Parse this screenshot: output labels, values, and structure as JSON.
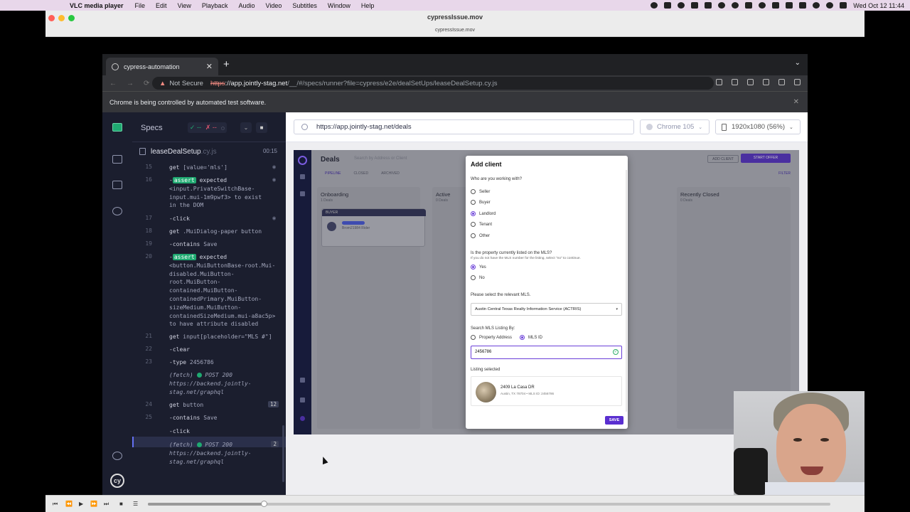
{
  "menubar": {
    "app_name": "VLC media player",
    "items": [
      "File",
      "Edit",
      "View",
      "Playback",
      "Audio",
      "Video",
      "Subtitles",
      "Window",
      "Help"
    ],
    "clock": "Wed Oct 12  11:44"
  },
  "vlc": {
    "title": "cypressIssue.mov",
    "subtitle": "cypressIssue.mov",
    "progress_fraction": 0.17
  },
  "chrome": {
    "tab_title": "cypress-automation",
    "new_tab": "+",
    "not_secure": "Not Secure",
    "url_scheme": "https",
    "url_host": "://app.jointly-stag.net",
    "url_path": "/__/#/specs/runner?file=cypress/e2e/dealSetUps/leaseDealSetup.cy.js",
    "infobar": "Chrome is being controlled by automated test software."
  },
  "reporter": {
    "specs_label": "Specs",
    "passed": "✓ --",
    "failed": "✗ --",
    "pending": "◌",
    "spec_file": "leaseDealSetup",
    "spec_ext": ".cy.js",
    "duration": "00:15",
    "commands": [
      {
        "n": "15",
        "name": "get",
        "arg": "[value='mls']"
      },
      {
        "n": "16",
        "badge": "assert",
        "l1": "expected",
        "rest": [
          "<input.PrivateSwitchBase-",
          "input.mui-1m9pwf3> to exist",
          "in the DOM"
        ]
      },
      {
        "n": "17",
        "name": "-click",
        "arg": ""
      },
      {
        "n": "18",
        "name": "get",
        "arg": ".MuiDialog-paper button"
      },
      {
        "n": "19",
        "name": "-contains",
        "arg": "Save"
      },
      {
        "n": "20",
        "badge": "assert",
        "l1": "expected",
        "rest": [
          "<button.MuiButtonBase-root.Mui-",
          "disabled.MuiButton-",
          "root.MuiButton-",
          "contained.MuiButton-",
          "containedPrimary.MuiButton-",
          "sizeMedium.MuiButton-",
          "containedSizeMedium.mui-a8ac5p>",
          "to have attribute disabled"
        ]
      },
      {
        "n": "21",
        "name": "get",
        "arg": "input[placeholder=\"MLS #\"]"
      },
      {
        "n": "22",
        "name": "-clear",
        "arg": ""
      },
      {
        "n": "23",
        "name": "-type",
        "arg": "2456786"
      },
      {
        "n": "",
        "fetch": "(fetch)",
        "method": "POST 200",
        "url1": "https://backend.jointly-",
        "url2": "stag.net/graphql"
      },
      {
        "n": "24",
        "name": "get",
        "arg": "button",
        "count": "12"
      },
      {
        "n": "25",
        "name": "-contains",
        "arg": "Save"
      },
      {
        "n": "",
        "name": "-click",
        "arg": ""
      },
      {
        "n": "",
        "fetch": "(fetch)",
        "method": "POST 200",
        "url1": "https://backend.jointly-",
        "url2": "stag.net/graphql",
        "count": "2"
      }
    ]
  },
  "aut": {
    "url": "https://app.jointly-stag.net/deals",
    "browser": "Chrome 105",
    "viewport": "1920x1080 (56%)"
  },
  "app": {
    "page_title": "Deals",
    "search_placeholder": "Search by Address or Client",
    "add_client": "ADD CLIENT",
    "start_offer": "START OFFER",
    "tabs": [
      "PIPELINE",
      "CLOSED",
      "ARCHIVED"
    ],
    "filter": "FILTER",
    "columns": [
      {
        "title": "Onboarding",
        "sub": "1 Deals"
      },
      {
        "title": "Active",
        "sub": "0 Deals"
      },
      {
        "title": "Recently Closed",
        "sub": "0 Deals"
      }
    ],
    "card_header": "BUYER",
    "card_name": "Brom21984 Rider"
  },
  "modal": {
    "title": "Add client",
    "q1": "Who are you working with?",
    "roles": [
      "Seller",
      "Buyer",
      "Landlord",
      "Tenant",
      "Other"
    ],
    "selected_role": "Landlord",
    "q2": "Is the property currently listed on the MLS?",
    "q2_hint": "If you do not have the MLS number for the listing, select \"no\" to continue.",
    "yes": "Yes",
    "no": "No",
    "q3": "Please select the relevant MLS.",
    "mls_select": "Austin Central Texas Realty Information Service (ACTRIS)",
    "q4": "Search MLS Listing By:",
    "by_address": "Property Address",
    "by_id": "MLS ID",
    "mls_value": "2456786",
    "listing_label": "Listing selected",
    "listing_address": "2409 La Casa DR",
    "listing_sub": "Austin, TX 78704 • MLS ID: 2456786",
    "save": "SAVE"
  }
}
